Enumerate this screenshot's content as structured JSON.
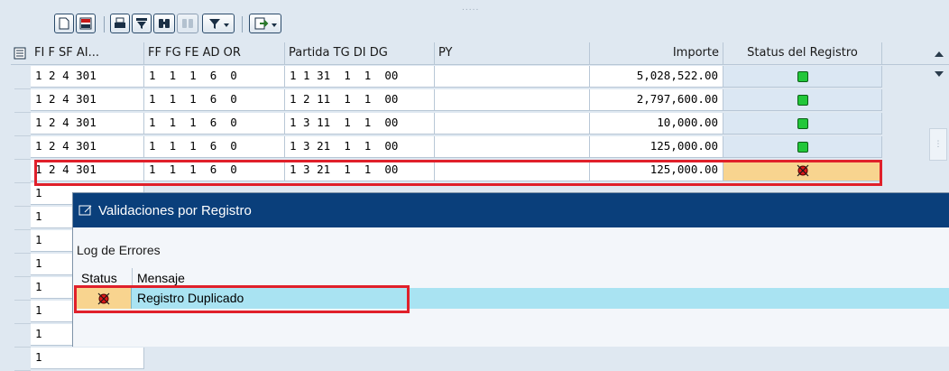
{
  "toolbar": {
    "dots": ".....",
    "buttons": [
      "new-document-icon",
      "layout-icon",
      "print-icon",
      "filter-icon",
      "find-icon",
      "find-next-icon",
      "filter-dropdown-icon",
      "export-dropdown-icon"
    ]
  },
  "grid": {
    "headers": {
      "col1": "FI F SF AI...",
      "col2": "FF FG FE AD OR",
      "col3": "Partida TG DI DG",
      "col4": "PY",
      "col5": "Importe",
      "col6": "Status del Registro"
    },
    "rows": [
      {
        "c1": "1 2 4 301",
        "c2": "1  1  1  6  0",
        "c3": "1 1 31  1  1  00",
        "c4": "",
        "importe": "5,028,522.00",
        "status": "ok"
      },
      {
        "c1": "1 2 4 301",
        "c2": "1  1  1  6  0",
        "c3": "1 2 11  1  1  00",
        "c4": "",
        "importe": "2,797,600.00",
        "status": "ok"
      },
      {
        "c1": "1 2 4 301",
        "c2": "1  1  1  6  0",
        "c3": "1 3 11  1  1  00",
        "c4": "",
        "importe": "10,000.00",
        "status": "ok"
      },
      {
        "c1": "1 2 4 301",
        "c2": "1  1  1  6  0",
        "c3": "1 3 21  1  1  00",
        "c4": "",
        "importe": "125,000.00",
        "status": "ok"
      },
      {
        "c1": "1 2 4 301",
        "c2": "1  1  1  6  0",
        "c3": "1 3 21  1  1  00",
        "c4": "",
        "importe": "125,000.00",
        "status": "error"
      }
    ],
    "hidden_rows_first_char": [
      "1",
      "1",
      "1",
      "1",
      "1",
      "1",
      "1",
      "1"
    ]
  },
  "popup": {
    "title": "Validaciones por Registro",
    "log_title": "Log de Errores",
    "col_status": "Status",
    "col_mensaje": "Mensaje",
    "rows": [
      {
        "status": "error",
        "mensaje": "Registro Duplicado"
      }
    ]
  },
  "colors": {
    "title_bar": "#0a3f7b",
    "highlight": "#e0202a",
    "status_ok": "#22c73a",
    "status_error": "#e01818",
    "error_cell": "#f8d48f",
    "selected_row": "#a9e3f2"
  }
}
